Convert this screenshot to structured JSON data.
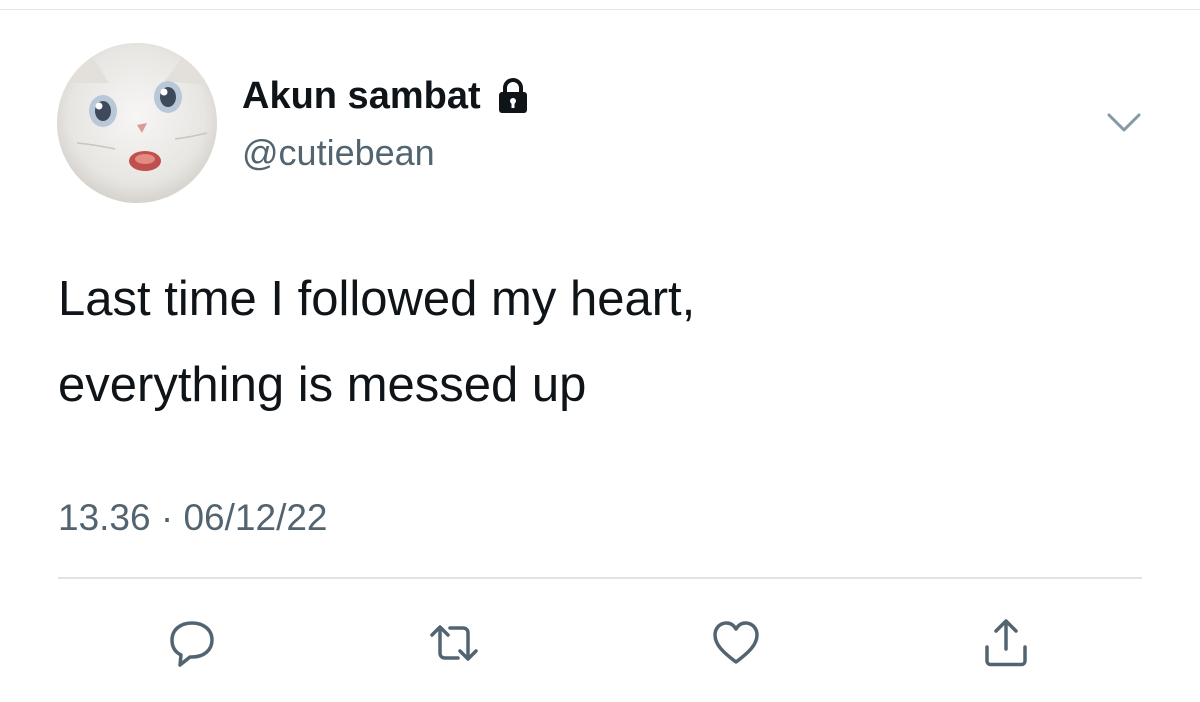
{
  "account": {
    "display_name": "Akun sambat",
    "handle": "@cutiebean",
    "avatar_icon": "cat-avatar",
    "protected_icon": "lock-icon"
  },
  "tweet": {
    "lines": [
      "Last time I followed my heart,",
      "everything is messed up"
    ],
    "time": "13.36",
    "separator": "·",
    "date": "06/12/22"
  },
  "actions": [
    {
      "icon": "reply-icon"
    },
    {
      "icon": "retweet-icon"
    },
    {
      "icon": "like-icon"
    },
    {
      "icon": "share-icon"
    }
  ],
  "menu": {
    "icon": "chevron-down-icon"
  },
  "colors": {
    "text": "#0f1419",
    "secondary": "#536471",
    "divider": "#e1e4e6"
  }
}
